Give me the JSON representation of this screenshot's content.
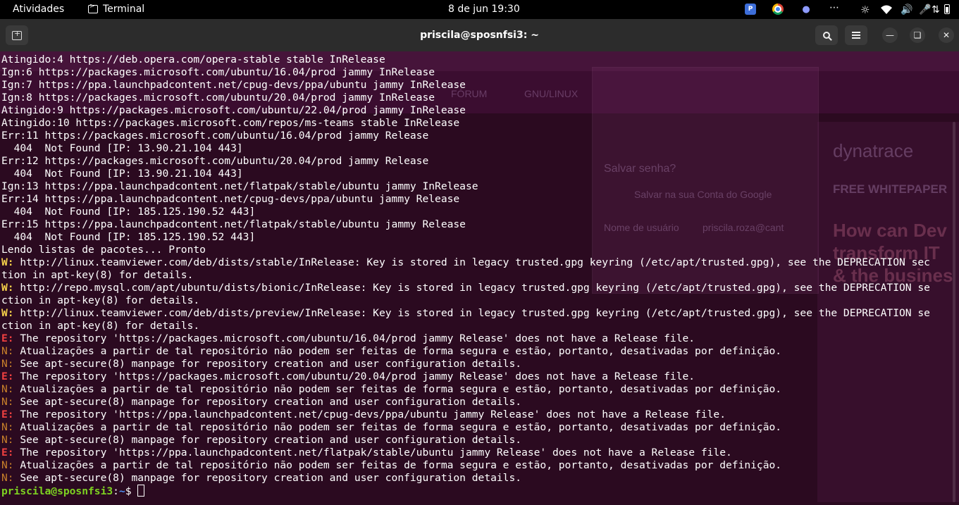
{
  "topbar": {
    "activities": "Atividades",
    "app_name": "Terminal",
    "clock": "8 de jun  19:30",
    "tray_icons": [
      "p-app-icon",
      "chrome-icon",
      "teams-icon",
      "overflow-dots-icon",
      "brightness-icon",
      "wifi-icon",
      "volume-icon",
      "mic-icon",
      "settings-icon",
      "battery-icon"
    ]
  },
  "window": {
    "title": "priscila@sposnfsi3: ~"
  },
  "background_ghost": {
    "brand": "dynatrace",
    "whitepaper": "FREE WHITEPAPER",
    "headline1": "How can Dev",
    "headline2": "transform IT",
    "headline3": "& the busines",
    "save_password": "Salvar senha?",
    "save_google": "Salvar na sua Conta do Google",
    "username_label": "Nome de usuário",
    "username_value": "priscila.roza@cant",
    "forum": "FÓRUM",
    "gnu": "GNU/LINUX"
  },
  "terminal": {
    "lines": [
      {
        "p": "",
        "t": "Atingido:4 https://deb.opera.com/opera-stable stable InRelease"
      },
      {
        "p": "",
        "t": "Ign:6 https://packages.microsoft.com/ubuntu/16.04/prod jammy InRelease"
      },
      {
        "p": "",
        "t": "Ign:7 https://ppa.launchpadcontent.net/cpug-devs/ppa/ubuntu jammy InRelease"
      },
      {
        "p": "",
        "t": "Ign:8 https://packages.microsoft.com/ubuntu/20.04/prod jammy InRelease"
      },
      {
        "p": "",
        "t": "Atingido:9 https://packages.microsoft.com/ubuntu/22.04/prod jammy InRelease"
      },
      {
        "p": "",
        "t": "Atingido:10 https://packages.microsoft.com/repos/ms-teams stable InRelease"
      },
      {
        "p": "",
        "t": "Err:11 https://packages.microsoft.com/ubuntu/16.04/prod jammy Release"
      },
      {
        "p": "",
        "t": "  404  Not Found [IP: 13.90.21.104 443]"
      },
      {
        "p": "",
        "t": "Err:12 https://packages.microsoft.com/ubuntu/20.04/prod jammy Release"
      },
      {
        "p": "",
        "t": "  404  Not Found [IP: 13.90.21.104 443]"
      },
      {
        "p": "",
        "t": "Ign:13 https://ppa.launchpadcontent.net/flatpak/stable/ubuntu jammy InRelease"
      },
      {
        "p": "",
        "t": "Err:14 https://ppa.launchpadcontent.net/cpug-devs/ppa/ubuntu jammy Release"
      },
      {
        "p": "",
        "t": "  404  Not Found [IP: 185.125.190.52 443]"
      },
      {
        "p": "",
        "t": "Err:15 https://ppa.launchpadcontent.net/flatpak/stable/ubuntu jammy Release"
      },
      {
        "p": "",
        "t": "  404  Not Found [IP: 185.125.190.52 443]"
      },
      {
        "p": "",
        "t": "Lendo listas de pacotes... Pronto"
      },
      {
        "p": "W:",
        "t": " http://linux.teamviewer.com/deb/dists/stable/InRelease: Key is stored in legacy trusted.gpg keyring (/etc/apt/trusted.gpg), see the DEPRECATION sec"
      },
      {
        "p": "",
        "t": "tion in apt-key(8) for details."
      },
      {
        "p": "W:",
        "t": " http://repo.mysql.com/apt/ubuntu/dists/bionic/InRelease: Key is stored in legacy trusted.gpg keyring (/etc/apt/trusted.gpg), see the DEPRECATION se"
      },
      {
        "p": "",
        "t": "ction in apt-key(8) for details."
      },
      {
        "p": "W:",
        "t": " http://linux.teamviewer.com/deb/dists/preview/InRelease: Key is stored in legacy trusted.gpg keyring (/etc/apt/trusted.gpg), see the DEPRECATION se"
      },
      {
        "p": "",
        "t": "ction in apt-key(8) for details."
      },
      {
        "p": "E:",
        "t": " The repository 'https://packages.microsoft.com/ubuntu/16.04/prod jammy Release' does not have a Release file."
      },
      {
        "p": "N:",
        "t": " Atualizações a partir de tal repositório não podem ser feitas de forma segura e estão, portanto, desativadas por definição."
      },
      {
        "p": "N:",
        "t": " See apt-secure(8) manpage for repository creation and user configuration details."
      },
      {
        "p": "E:",
        "t": " The repository 'https://packages.microsoft.com/ubuntu/20.04/prod jammy Release' does not have a Release file."
      },
      {
        "p": "N:",
        "t": " Atualizações a partir de tal repositório não podem ser feitas de forma segura e estão, portanto, desativadas por definição."
      },
      {
        "p": "N:",
        "t": " See apt-secure(8) manpage for repository creation and user configuration details."
      },
      {
        "p": "E:",
        "t": " The repository 'https://ppa.launchpadcontent.net/cpug-devs/ppa/ubuntu jammy Release' does not have a Release file."
      },
      {
        "p": "N:",
        "t": " Atualizações a partir de tal repositório não podem ser feitas de forma segura e estão, portanto, desativadas por definição."
      },
      {
        "p": "N:",
        "t": " See apt-secure(8) manpage for repository creation and user configuration details."
      },
      {
        "p": "E:",
        "t": " The repository 'https://ppa.launchpadcontent.net/flatpak/stable/ubuntu jammy Release' does not have a Release file."
      },
      {
        "p": "N:",
        "t": " Atualizações a partir de tal repositório não podem ser feitas de forma segura e estão, portanto, desativadas por definição."
      },
      {
        "p": "N:",
        "t": " See apt-secure(8) manpage for repository creation and user configuration details."
      }
    ],
    "prompt_user": "priscila@sposnfsi3",
    "prompt_sep": ":",
    "prompt_path": "~",
    "prompt_sym": "$ "
  },
  "colors": {
    "terminal_bg": "#2b0a20",
    "warning": "#f5d04a",
    "error": "#ef4040",
    "note": "#c8802a",
    "prompt_user": "#7ed321",
    "prompt_path": "#4f8ff7"
  }
}
